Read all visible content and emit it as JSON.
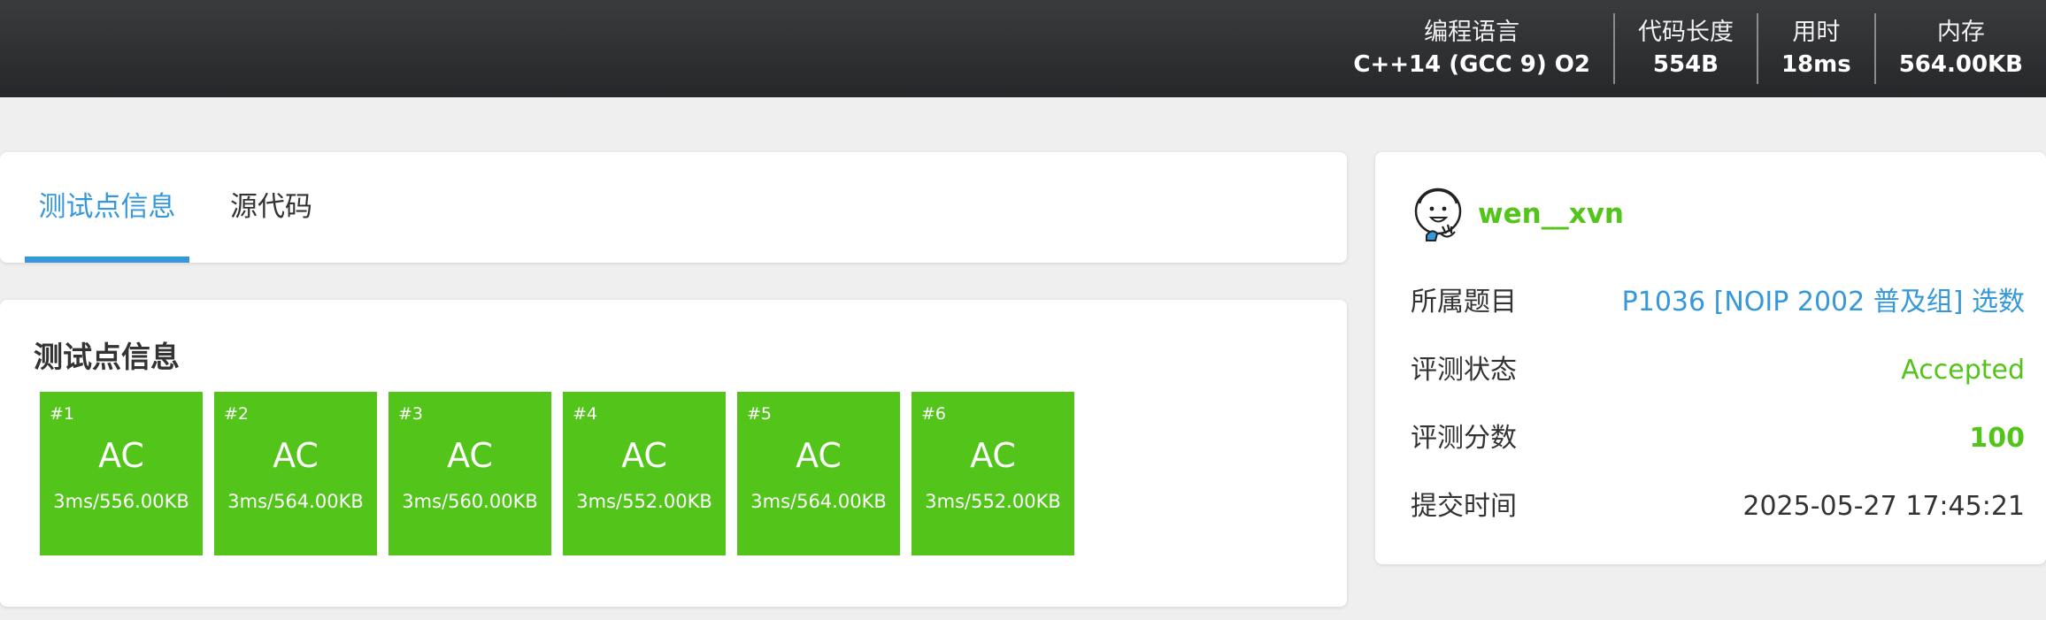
{
  "header": {
    "stats": [
      {
        "label": "编程语言",
        "value": "C++14 (GCC 9) O2"
      },
      {
        "label": "代码长度",
        "value": "554B"
      },
      {
        "label": "用时",
        "value": "18ms"
      },
      {
        "label": "内存",
        "value": "564.00KB"
      }
    ]
  },
  "tabs": [
    {
      "label": "测试点信息",
      "active": true
    },
    {
      "label": "源代码",
      "active": false
    }
  ],
  "tests": {
    "title": "测试点信息",
    "cases": [
      {
        "num": "#1",
        "status": "AC",
        "detail": "3ms/556.00KB"
      },
      {
        "num": "#2",
        "status": "AC",
        "detail": "3ms/564.00KB"
      },
      {
        "num": "#3",
        "status": "AC",
        "detail": "3ms/560.00KB"
      },
      {
        "num": "#4",
        "status": "AC",
        "detail": "3ms/552.00KB"
      },
      {
        "num": "#5",
        "status": "AC",
        "detail": "3ms/564.00KB"
      },
      {
        "num": "#6",
        "status": "AC",
        "detail": "3ms/552.00KB"
      }
    ]
  },
  "submission": {
    "username": "wen__xvn",
    "problem_label": "所属题目",
    "problem_value": "P1036 [NOIP 2002 普及组] 选数",
    "status_label": "评测状态",
    "status_value": "Accepted",
    "score_label": "评测分数",
    "score_value": "100",
    "time_label": "提交时间",
    "time_value": "2025-05-27 17:45:21"
  },
  "colors": {
    "accent": "#3498db",
    "success": "#52c41a",
    "header_bg": "#2e2f31",
    "page_bg": "#efefef"
  }
}
